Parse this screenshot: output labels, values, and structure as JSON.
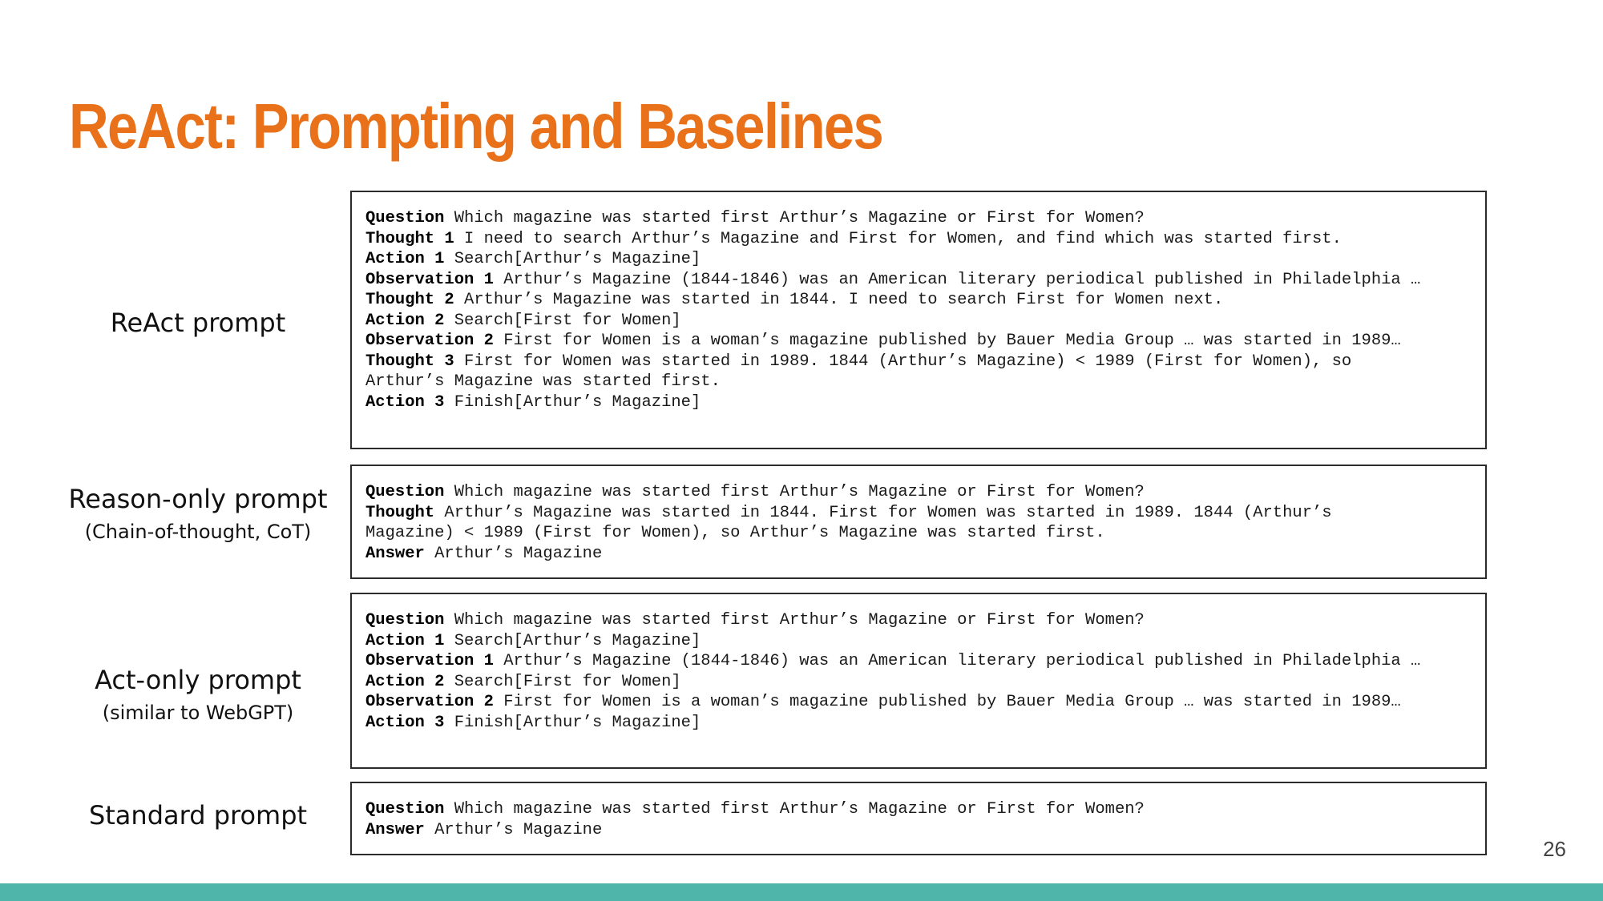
{
  "title": "ReAct: Prompting and Baselines",
  "page_number": "26",
  "colors": {
    "title": "#e8711a",
    "bottom_bar": "#4fb5aa"
  },
  "rows": [
    {
      "label": "ReAct prompt",
      "sublabel": "",
      "lines": [
        {
          "key": "Question",
          "text": " Which magazine was started first Arthur’s Magazine or First for Women?"
        },
        {
          "key": "Thought 1",
          "text": " I need to search Arthur’s Magazine and First for Women, and find which was started first."
        },
        {
          "key": "Action 1",
          "text": " Search[Arthur’s Magazine]"
        },
        {
          "key": "Observation 1",
          "text": " Arthur’s Magazine (1844-1846) was an American literary periodical published in Philadelphia …"
        },
        {
          "key": "Thought 2",
          "text": " Arthur’s Magazine was started in 1844. I need to search First for Women next."
        },
        {
          "key": "Action 2",
          "text": " Search[First for Women]"
        },
        {
          "key": "Observation 2",
          "text": " First for Women is a woman’s magazine published by Bauer Media Group … was started in 1989…"
        },
        {
          "key": "Thought 3",
          "text": " First for Women was started in 1989. 1844 (Arthur’s Magazine) < 1989 (First for Women), so"
        },
        {
          "key": "",
          "text": "Arthur’s Magazine was started first."
        },
        {
          "key": "Action 3",
          "text": " Finish[Arthur’s Magazine]"
        }
      ]
    },
    {
      "label": "Reason-only prompt",
      "sublabel": "(Chain-of-thought, CoT)",
      "lines": [
        {
          "key": "Question",
          "text": " Which magazine was started first Arthur’s Magazine or First for Women?"
        },
        {
          "key": "Thought",
          "text": " Arthur’s Magazine was started in 1844. First for Women was started in 1989. 1844 (Arthur’s"
        },
        {
          "key": "",
          "text": "Magazine) < 1989 (First for Women), so Arthur’s Magazine was started first."
        },
        {
          "key": "Answer",
          "text": " Arthur’s Magazine"
        }
      ]
    },
    {
      "label": "Act-only prompt",
      "sublabel": "(similar to WebGPT)",
      "lines": [
        {
          "key": "Question",
          "text": " Which magazine was started first Arthur’s Magazine or First for Women?"
        },
        {
          "key": "Action 1",
          "text": " Search[Arthur’s Magazine]"
        },
        {
          "key": "Observation 1",
          "text": " Arthur’s Magazine (1844-1846) was an American literary periodical published in Philadelphia …"
        },
        {
          "key": "Action 2",
          "text": " Search[First for Women]"
        },
        {
          "key": "Observation 2",
          "text": " First for Women is a woman’s magazine published by Bauer Media Group … was started in 1989…"
        },
        {
          "key": "Action 3",
          "text": " Finish[Arthur’s Magazine]"
        }
      ]
    },
    {
      "label": "Standard prompt",
      "sublabel": "",
      "lines": [
        {
          "key": "Question",
          "text": " Which magazine was started first Arthur’s Magazine or First for Women?"
        },
        {
          "key": "Answer",
          "text": " Arthur’s Magazine"
        }
      ]
    }
  ]
}
